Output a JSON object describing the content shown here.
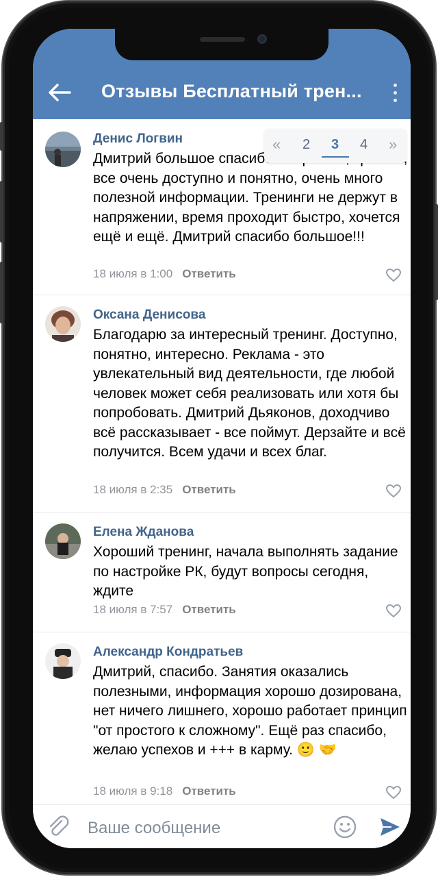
{
  "header": {
    "title": "Отзывы Бесплатный трен..."
  },
  "pager": {
    "prev": "«",
    "pages": [
      "2",
      "3",
      "4"
    ],
    "current": "3",
    "next": "»"
  },
  "comments": [
    {
      "author": "Денис Логвин",
      "text": "Дмитрий большое спасибо за тренинг, тренинг, все очень доступно и понятно, очень много полезной информации. Тренинги не держут в напряжении, время проходит быстро, хочется ещё и ещё. Дмитрий спасибо большое!!!",
      "time": "18 июля в 1:00",
      "reply": "Ответить"
    },
    {
      "author": "Оксана Денисова",
      "text": "Благодарю за интересный тренинг. Доступно, понятно, интересно. Реклама - это увлекательный вид деятельности, где любой человек может себя реализовать или хотя бы попробовать. Дмитрий Дьяконов, доходчиво всё рассказывает - все поймут. Дерзайте и всё получится. Всем удачи и всех благ.",
      "time": "18 июля в 2:35",
      "reply": "Ответить"
    },
    {
      "author": "Елена Жданова",
      "text": "Хороший тренинг, начала выполнять задание по настройке РК, будут вопросы сегодня, ждите",
      "time": "18 июля в 7:57",
      "reply": "Ответить"
    },
    {
      "author": "Александр Кондратьев",
      "text": "Дмитрий, спасибо. Занятия оказались полезными, информация хорошо дозирована, нет ничего лишнего, хорошо работает принцип \"от простого к сложному\". Ещё раз спасибо, желаю успехов и +++ в карму. 🙂 🤝",
      "time": "18 июля в 9:18",
      "reply": "Ответить"
    }
  ],
  "composer": {
    "placeholder": "Ваше сообщение"
  },
  "colors": {
    "header": "#5181b8",
    "author": "#42648b",
    "meta": "#909499",
    "send": "#4a76a8"
  }
}
